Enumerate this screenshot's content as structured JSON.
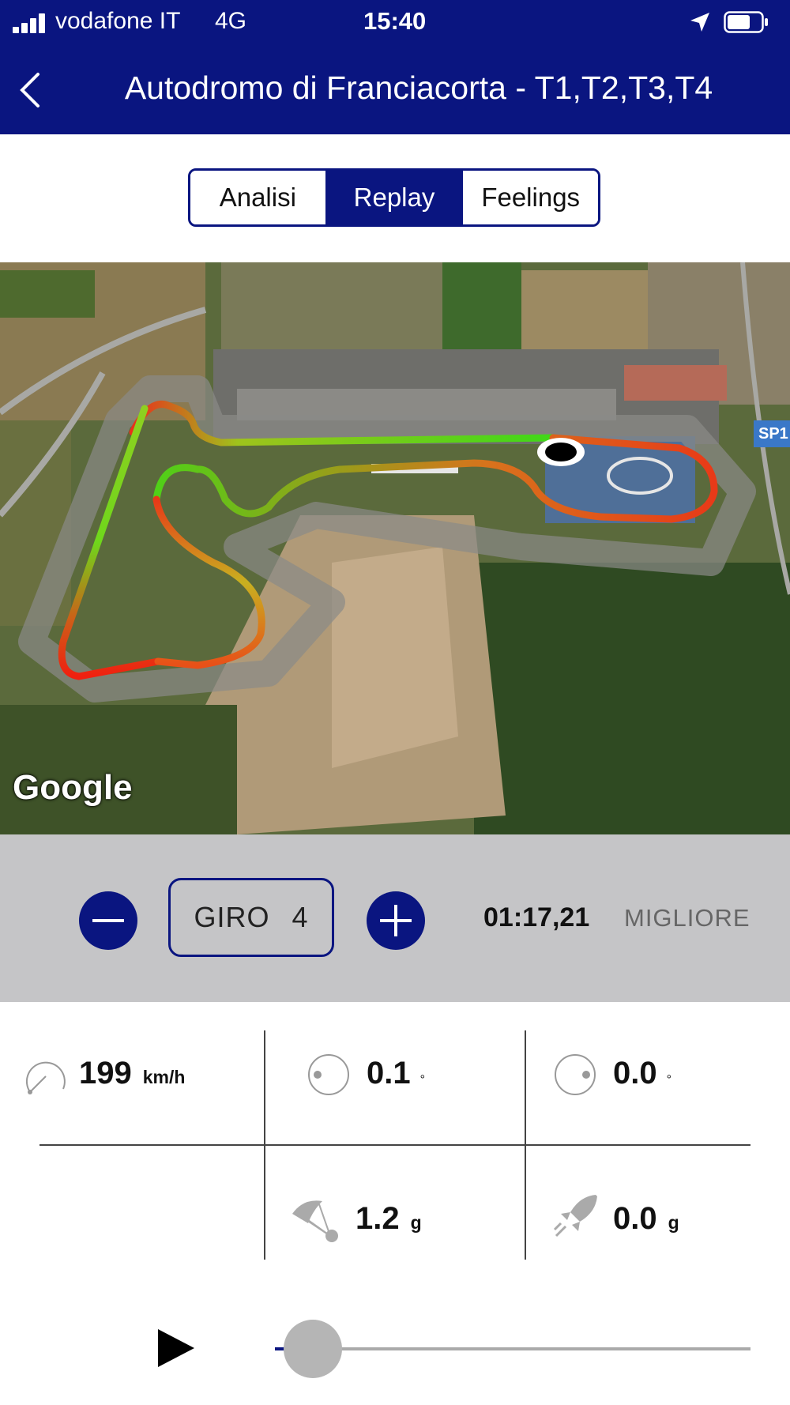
{
  "status_bar": {
    "carrier": "vodafone IT",
    "network": "4G",
    "time": "15:40",
    "icons": [
      "signal-icon",
      "location-icon",
      "battery-icon"
    ]
  },
  "nav": {
    "back_icon": "chevron-left-icon",
    "title": "Autodromo di Franciacorta - T1,T2,T3,T4"
  },
  "tabs": [
    {
      "label": "Analisi",
      "active": false
    },
    {
      "label": "Replay",
      "active": true
    },
    {
      "label": "Feelings",
      "active": false
    }
  ],
  "map": {
    "provider_logo": "Google",
    "road_badge": "SP1",
    "marker": "position-marker"
  },
  "lap": {
    "label": "GIRO",
    "number": "4",
    "time": "01:17,21",
    "best_label": "MIGLIORE",
    "minus_icon": "minus-icon",
    "plus_icon": "plus-icon"
  },
  "telemetry": {
    "speed": {
      "icon": "speedometer-icon",
      "value": "199",
      "unit": "km/h"
    },
    "lean": {
      "icon": "lean-angle-icon",
      "value": "0.1",
      "unit": "°"
    },
    "angle2": {
      "icon": "lean-angle-icon",
      "value": "0.0",
      "unit": "°"
    },
    "braking": {
      "icon": "parachute-icon",
      "value": "1.2",
      "unit": "g"
    },
    "acceleration": {
      "icon": "rocket-icon",
      "value": "0.0",
      "unit": "g"
    }
  },
  "replay": {
    "play_icon": "play-icon",
    "progress": 0.08
  },
  "colors": {
    "brand_navy": "#0a1580",
    "band_gray": "#c5c5c7"
  }
}
